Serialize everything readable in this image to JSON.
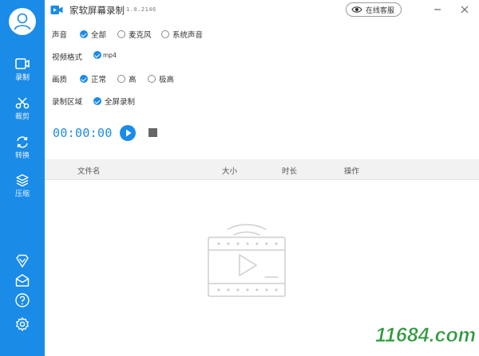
{
  "app": {
    "title": "家软屏幕录制",
    "version": "1.0.2146",
    "support_label": "在线客服"
  },
  "sidebar": {
    "items": [
      {
        "label": "录制",
        "icon": "screen-record-icon",
        "active": true
      },
      {
        "label": "裁剪",
        "icon": "scissors-icon",
        "active": false
      },
      {
        "label": "转换",
        "icon": "convert-icon",
        "active": false
      },
      {
        "label": "压缩",
        "icon": "compress-icon",
        "active": false
      }
    ],
    "bottom_icons": [
      "vip-diamond-icon",
      "mail-icon",
      "help-icon",
      "settings-icon"
    ]
  },
  "settings": {
    "audio": {
      "label": "声音",
      "options": [
        {
          "label": "全部",
          "checked": true
        },
        {
          "label": "麦克风",
          "checked": false
        },
        {
          "label": "系统声音",
          "checked": false
        }
      ]
    },
    "format": {
      "label": "视频格式",
      "options": [
        {
          "label": "mp4",
          "checked": true
        }
      ]
    },
    "quality": {
      "label": "画质",
      "options": [
        {
          "label": "正常",
          "checked": true
        },
        {
          "label": "高",
          "checked": false
        },
        {
          "label": "极高",
          "checked": false
        }
      ]
    },
    "area": {
      "label": "录制区域",
      "options": [
        {
          "label": "全屏录制",
          "checked": true
        }
      ]
    }
  },
  "timer": {
    "value": "00:00:00"
  },
  "table": {
    "columns": [
      "文件名",
      "大小",
      "时长",
      "操作"
    ],
    "rows": []
  },
  "watermark": {
    "text": "11684.com"
  },
  "colors": {
    "accent": "#1b8be8",
    "sidebar": "#1b8be8",
    "header_bg": "#f2f2f2",
    "watermark": "#2e9a3c"
  }
}
